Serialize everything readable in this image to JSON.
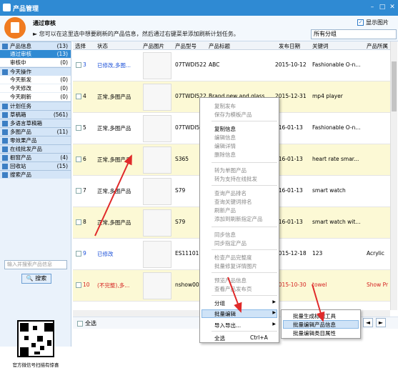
{
  "window": {
    "title": "产品管理"
  },
  "notice": {
    "heading": "通过审核",
    "message": "► 您可以在这里选中想要刷新的产品信息，然后通过右键菜单添加刷新计划任务。",
    "show_images_label": "显示图片",
    "group_select": "所有分组"
  },
  "sidebar": {
    "sections": [
      {
        "label": "产品信息",
        "count": "(13)",
        "items": [
          {
            "label": "通过审核",
            "count": "(13)",
            "active": true
          },
          {
            "label": "审核中",
            "count": "(0)"
          }
        ]
      },
      {
        "label": "今天操作",
        "items": [
          {
            "label": "今天新发",
            "count": "(0)"
          },
          {
            "label": "今天修改",
            "count": "(0)"
          },
          {
            "label": "今天刷新",
            "count": "(0)"
          }
        ]
      },
      {
        "label": "计划任务",
        "items": []
      },
      {
        "label": "草稿箱",
        "count": "(561)",
        "items": []
      },
      {
        "label": "多语言草稿箱",
        "items": []
      },
      {
        "label": "多图产品",
        "count": "(11)",
        "items": []
      },
      {
        "label": "零效果产品",
        "items": []
      },
      {
        "label": "在线批发产品",
        "items": []
      },
      {
        "label": "橱窗产品",
        "count": "(4)",
        "items": []
      },
      {
        "label": "回收站",
        "count": "(15)",
        "items": []
      },
      {
        "label": "搜索产品",
        "items": []
      }
    ],
    "search_placeholder": "输入并搜索产品信息",
    "search_button": "搜索",
    "qr_caption": "官方微信号扫描有惊喜"
  },
  "grid": {
    "columns": [
      "选择",
      "状态",
      "产品图片",
      "产品型号",
      "产品标题",
      "发布日期",
      "关键词",
      "产品所属"
    ],
    "rows": [
      {
        "num": "3",
        "status": "已修改,多图...",
        "status_color": "#1a4fd8",
        "model": "07TWDI522",
        "title": "ABC",
        "date": "2015-10-12",
        "keyword": "Fashionable O-n...",
        "extra": ""
      },
      {
        "num": "4",
        "status": "正常,多图产品",
        "status_color": "#000000",
        "model": "07TWDI522",
        "title": "Brand new and glass",
        "date": "2015-12-31",
        "keyword": "mp4 player",
        "extra": ""
      },
      {
        "num": "5",
        "status": "正常,多图产品",
        "status_color": "#000000",
        "model": "07TWDI522",
        "title": "",
        "date": "016-01-13",
        "keyword": "Fashionable O-n...",
        "extra": ""
      },
      {
        "num": "6",
        "status": "正常,多图产品",
        "status_color": "#000000",
        "model": "S365",
        "title": "",
        "date": "016-01-13",
        "keyword": "heart rate smar...",
        "extra": ""
      },
      {
        "num": "7",
        "status": "正常,多图产品",
        "status_color": "#000000",
        "model": "S79",
        "title": "",
        "date": "016-01-13",
        "keyword": "smart watch",
        "extra": ""
      },
      {
        "num": "8",
        "status": "正常,多图产品",
        "status_color": "#000000",
        "model": "S79",
        "title": "",
        "date": "016-01-13",
        "keyword": "smart watch wit...",
        "extra": ""
      },
      {
        "num": "9",
        "status": "已修改",
        "status_color": "#1a4fd8",
        "model": "ES11101",
        "title": "",
        "date": "2015-12-18",
        "keyword": "123",
        "extra": "Acrylic"
      },
      {
        "num": "10",
        "status": "(不完整),多...",
        "status_color": "#d42020",
        "model": "nshow002",
        "title": "",
        "date": "2015-10-30",
        "keyword": "towel",
        "extra": "Show Pr"
      }
    ],
    "select_all_label": "全选"
  },
  "context_menu": {
    "items": [
      "复制发布",
      "保存为模板产品",
      "复制信息",
      "编辑信息",
      "编辑详情",
      "删除信息",
      "转为单图产品",
      "转为支持在线批发",
      "查询产品排名",
      "查询关键词排名",
      "刷新产品",
      "添加到刷新指定产品",
      "同步信息",
      "同步指定产品",
      "检查产品完整度",
      "批量修复详情图片",
      "预览产品信息",
      "查看产品发布页",
      "分组",
      "批量编辑",
      "导入导出...",
      "全选"
    ],
    "select_all_shortcut": "Ctrl+A"
  },
  "submenu": {
    "items": [
      "批量生成标题工具",
      "批量编辑产品信息",
      "批量编辑类目属性"
    ]
  }
}
